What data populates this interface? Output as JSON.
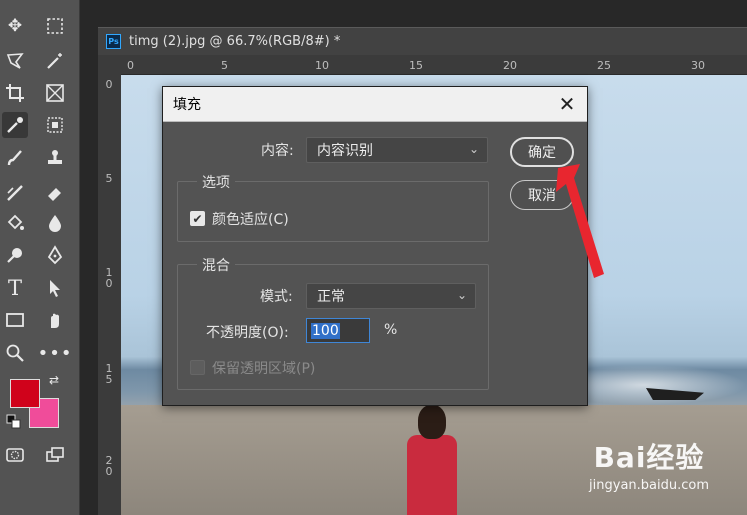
{
  "toolbar": {
    "tools": [
      "move-tool",
      "marquee-tool",
      "lasso-tool",
      "magic-wand-tool",
      "crop-tool",
      "frame-tool",
      "eyedropper-tool",
      "select-subject-tool",
      "brush-tool",
      "stamp-tool",
      "healing-tool",
      "eraser-tool",
      "paint-bucket-tool",
      "blur-tool",
      "dodge-tool",
      "pen-tool",
      "type-tool",
      "path-select-tool",
      "rectangle-tool",
      "hand-rotate-tool",
      "zoom-tool",
      "more-tools"
    ],
    "foreground_color": "#d0021b",
    "background_color": "#f04c9a"
  },
  "document": {
    "tab_title": "timg (2).jpg @ 66.7%(RGB/8#) *",
    "ps_badge": "Ps",
    "ruler_top_ticks": [
      "0",
      "5",
      "10",
      "15",
      "20",
      "25",
      "30"
    ],
    "ruler_left_ticks": [
      "0",
      "5",
      "10",
      "15",
      "20"
    ]
  },
  "dialog": {
    "title": "填充",
    "close_symbol": "✕",
    "content_label": "内容:",
    "content_value": "内容识别",
    "options_group_title": "选项",
    "color_adapt_label": "颜色适应(C)",
    "color_adapt_checked": true,
    "blend_group_title": "混合",
    "mode_label": "模式:",
    "mode_value": "正常",
    "opacity_label": "不透明度(O):",
    "opacity_value": "100",
    "opacity_unit": "%",
    "preserve_transparency_label": "保留透明区域(P)",
    "preserve_transparency_checked": false,
    "ok_label": "确定",
    "cancel_label": "取消"
  },
  "watermark": {
    "main": "Bai经验",
    "sub": "jingyan.baidu.com"
  },
  "colors": {
    "arrow": "#e8262f",
    "accent": "#31a8ff"
  }
}
